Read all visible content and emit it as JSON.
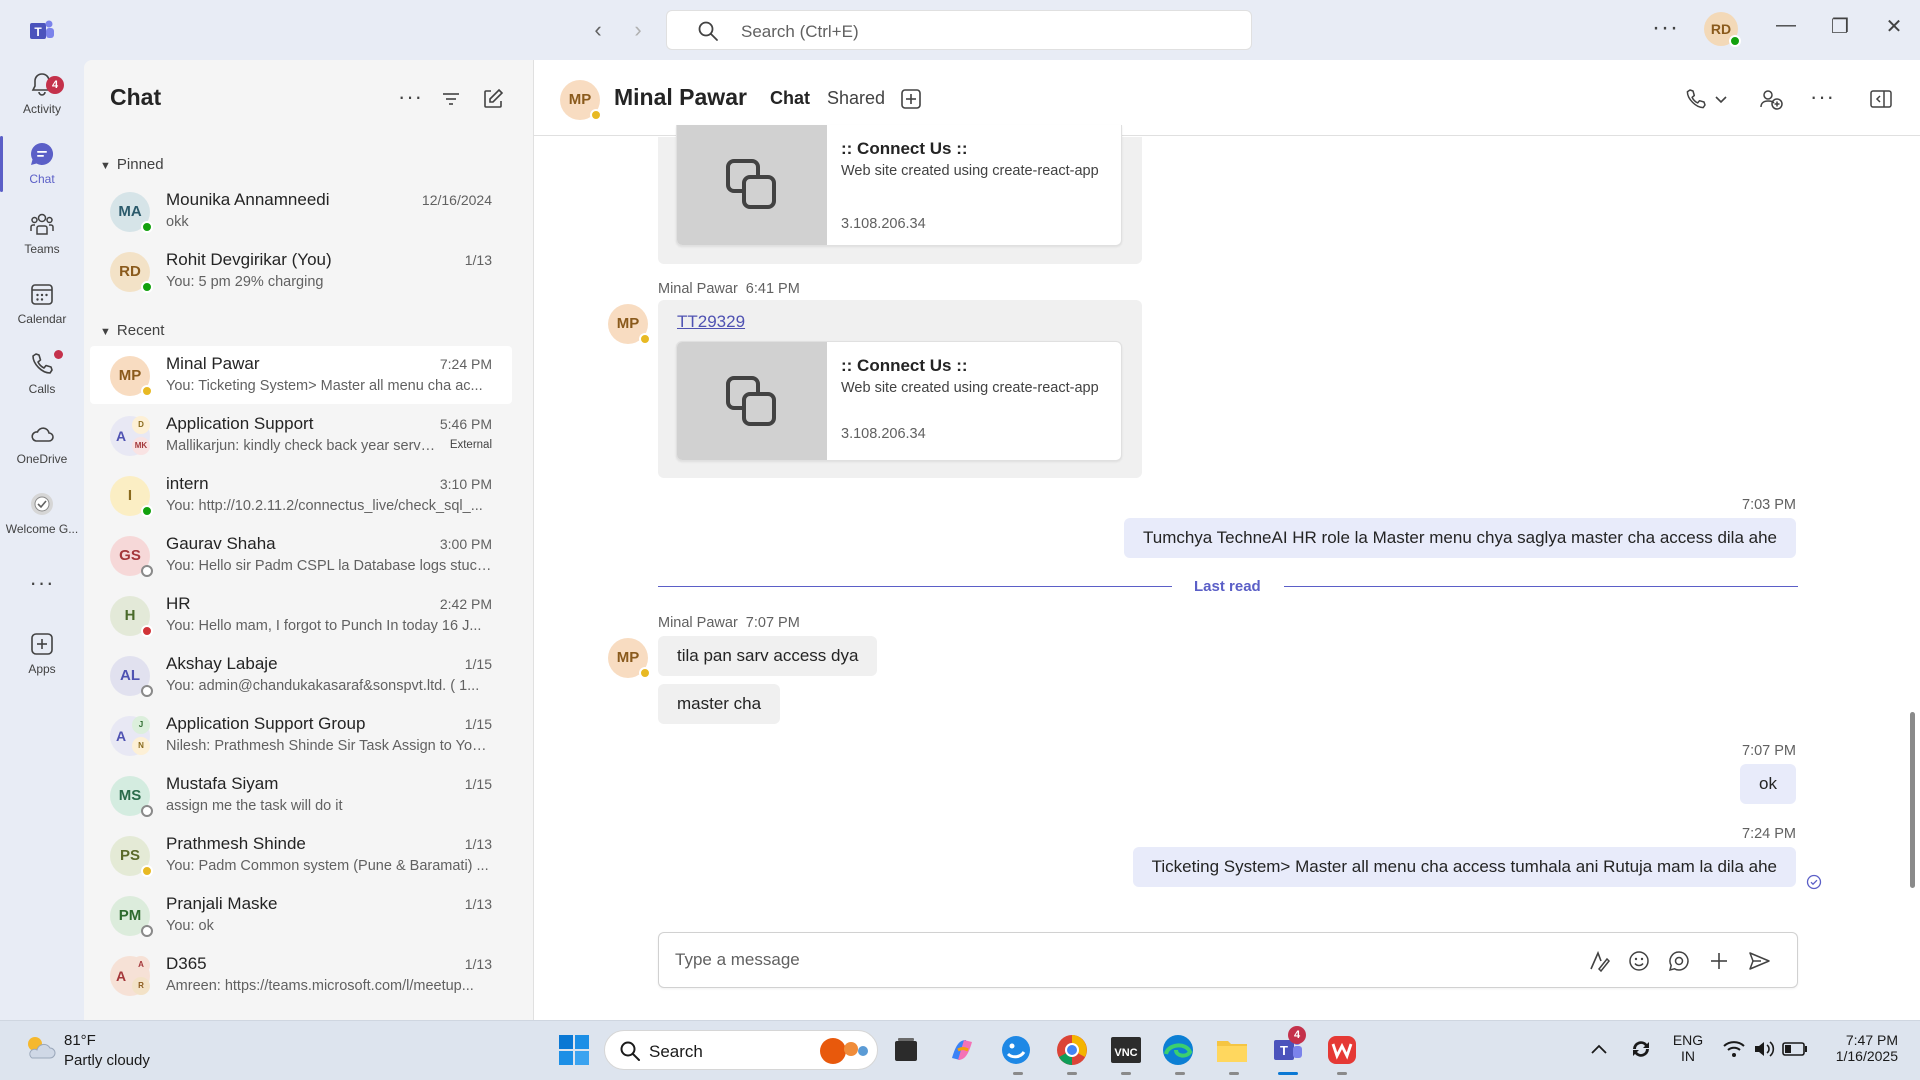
{
  "window": {
    "search_placeholder": "Search (Ctrl+E)",
    "user_initials": "RD"
  },
  "rail": {
    "items": [
      {
        "label": "Activity",
        "badge": "4"
      },
      {
        "label": "Chat"
      },
      {
        "label": "Teams"
      },
      {
        "label": "Calendar"
      },
      {
        "label": "Calls"
      },
      {
        "label": "OneDrive"
      },
      {
        "label": "Welcome G..."
      },
      {
        "label": "Apps"
      }
    ]
  },
  "chatlist": {
    "title": "Chat",
    "pinned_label": "Pinned",
    "recent_label": "Recent",
    "pinned": [
      {
        "initials": "MA",
        "name": "Mounika Annamneedi",
        "time": "12/16/2024",
        "preview": "okk"
      },
      {
        "initials": "RD",
        "name": "Rohit Devgirikar (You)",
        "time": "1/13",
        "preview": "You: 5 pm 29% charging"
      }
    ],
    "recent": [
      {
        "initials": "MP",
        "name": "Minal Pawar",
        "time": "7:24 PM",
        "preview": "You: Ticketing System> Master all menu cha ac..."
      },
      {
        "initials": "A",
        "name": "Application Support",
        "time": "5:46 PM",
        "preview": "Mallikarjun: kindly check back year serve...",
        "tag": "External",
        "sub1": "D",
        "sub2": "MK"
      },
      {
        "initials": "I",
        "name": "intern",
        "time": "3:10 PM",
        "preview": "You: http://10.2.11.2/connectus_live/check_sql_..."
      },
      {
        "initials": "GS",
        "name": "Gaurav Shaha",
        "time": "3:00 PM",
        "preview": "You: Hello sir Padm CSPL la Database logs stuck..."
      },
      {
        "initials": "H",
        "name": "HR",
        "time": "2:42 PM",
        "preview": "You: Hello mam, I forgot to Punch In today 16 J..."
      },
      {
        "initials": "AL",
        "name": "Akshay Labaje",
        "time": "1/15",
        "preview": "You: admin@chandukakasaraf&sonspvt.ltd.  ( 1..."
      },
      {
        "initials": "A",
        "name": "Application Support Group",
        "time": "1/15",
        "preview": "Nilesh: Prathmesh Shinde Sir Task Assign to You...",
        "sub1": "J",
        "sub2": "N"
      },
      {
        "initials": "MS",
        "name": "Mustafa Siyam",
        "time": "1/15",
        "preview": "assign me the task will do it"
      },
      {
        "initials": "PS",
        "name": "Prathmesh Shinde",
        "time": "1/13",
        "preview": "You: Padm Common system (Pune & Baramati) ..."
      },
      {
        "initials": "PM",
        "name": "Pranjali Maske",
        "time": "1/13",
        "preview": "You: ok"
      },
      {
        "initials": "A",
        "name": "D365",
        "time": "1/13",
        "preview": "Amreen: https://teams.microsoft.com/l/meetup...",
        "sub1": "A",
        "sub2": "R"
      }
    ]
  },
  "header": {
    "initials": "MP",
    "name": "Minal Pawar",
    "tabs": [
      "Chat",
      "Shared"
    ]
  },
  "messages": {
    "card1": {
      "title": ":: Connect Us ::",
      "desc": "Web site created using create-react-app",
      "url": "3.108.206.34"
    },
    "msg2_sender": "Minal Pawar",
    "msg2_time": "6:41 PM",
    "msg2_link": "TT29329",
    "card2": {
      "title": ":: Connect Us ::",
      "desc": "Web site created using create-react-app",
      "url": "3.108.206.34"
    },
    "out1_time": "7:03 PM",
    "out1_text": "Tumchya TechneAI HR role la Master menu chya saglya master cha access dila ahe",
    "last_read": "Last read",
    "msg3_sender": "Minal Pawar",
    "msg3_time": "7:07 PM",
    "msg3_text1": "tila pan sarv access dya",
    "msg3_text2": "master cha",
    "out2_time": "7:07 PM",
    "out2_text": "ok",
    "out3_time": "7:24 PM",
    "out3_text": "Ticketing System> Master all menu cha access tumhala ani Rutuja mam la dila ahe"
  },
  "composer": {
    "placeholder": "Type a message"
  },
  "taskbar": {
    "weather_temp": "81°F",
    "weather_desc": "Partly cloudy",
    "search_label": "Search",
    "teams_badge": "4",
    "lang1": "ENG",
    "lang2": "IN",
    "time": "7:47 PM",
    "date": "1/16/2025"
  }
}
